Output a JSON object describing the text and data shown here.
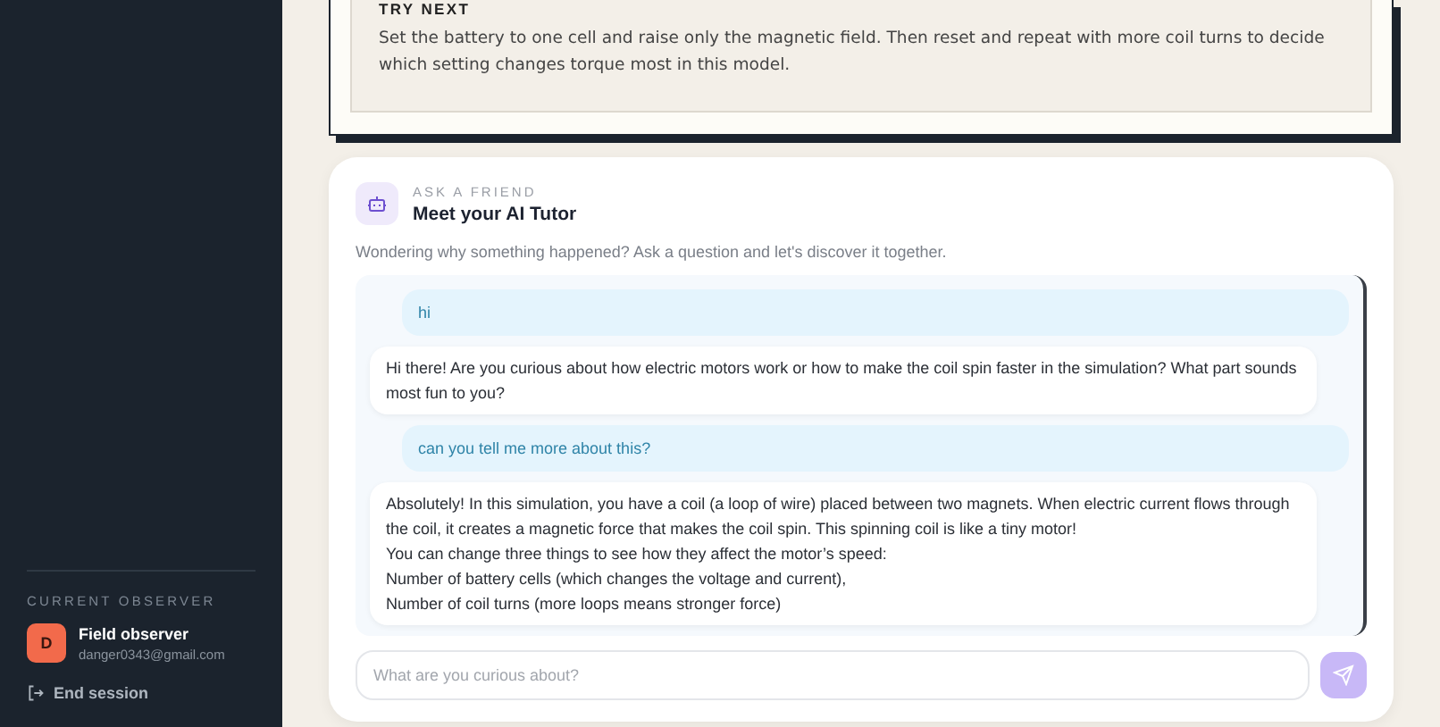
{
  "sidebar": {
    "observer_heading": "CURRENT OBSERVER",
    "observer": {
      "initial": "D",
      "name": "Field observer",
      "email": "danger0343@gmail.com"
    },
    "end_session": "End session"
  },
  "try_next": {
    "heading": "TRY NEXT",
    "text": "Set the battery to one cell and raise only the magnetic field. Then reset and repeat with more coil turns to decide which setting changes torque most in this model."
  },
  "tutor": {
    "eyebrow": "ASK A FRIEND",
    "title": "Meet your AI Tutor",
    "description": "Wondering why something happened? Ask a question and let's discover it together.",
    "messages": [
      {
        "kind": "user",
        "lines": [
          "hi"
        ]
      },
      {
        "kind": "bot",
        "lines": [
          "Hi there! Are you curious about how electric motors work or how to make the coil spin faster in the simulation? What part sounds most fun to you?"
        ]
      },
      {
        "kind": "user",
        "lines": [
          "can you tell me more about this?"
        ]
      },
      {
        "kind": "bot",
        "lines": [
          "Absolutely! In this simulation, you have a coil (a loop of wire) placed between two magnets. When electric current flows through the coil, it creates a magnetic force that makes the coil spin. This spinning coil is like a tiny motor!",
          "You can change three things to see how they affect the motor’s speed:",
          "Number of battery cells (which changes the voltage and current),",
          "Number of coil turns (more loops means stronger force)"
        ]
      }
    ],
    "input": {
      "placeholder": "What are you curious about?"
    }
  }
}
